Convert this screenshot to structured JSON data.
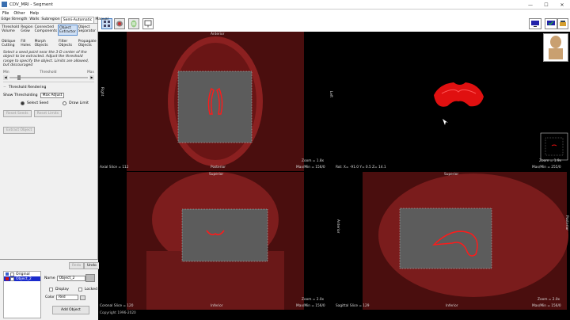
{
  "title_bar": {
    "title": "CDV_MRI - Segment",
    "minimize": "—",
    "maximize": "☐",
    "close": "✕"
  },
  "menu": [
    "File",
    "Other",
    "Help"
  ],
  "tabs": [
    "Edge Strength",
    "Walls",
    "Subregion",
    "Semi-Automatic",
    "Manual"
  ],
  "tools_row1": [
    "Threshold Volume",
    "Region Grow",
    "Connected Components",
    "Object Extractor",
    "Object Separator"
  ],
  "tools_row2": [
    "Oblique Cutting",
    "Fill Holes",
    "Morph Objects",
    "Filter Objects",
    "Propagate Objects"
  ],
  "description": "Select a seed point near the 3-D center of the object to be extracted. Adjust the threshold range to specify the object. Limits are allowed, but discouraged",
  "slider": {
    "min_label": "Min",
    "center_label": "Threshold",
    "max_label": "Max"
  },
  "threshold_rendering_label": "Threshold Rendering",
  "show_thresholding_label": "Show Thresholding",
  "show_thresholding_value": "Max Adjust",
  "radio_select_seed": "Select Seed",
  "radio_draw_limit": "Draw Limit",
  "reset_seeds": "Reset Seeds",
  "reset_limits": "Reset Limits",
  "extract_object": "Extract Object",
  "undo_panel": {
    "redo": "Redo",
    "undo": "Undo"
  },
  "objects": [
    {
      "name": "Original",
      "color": "#3a5fcd"
    },
    {
      "name": "Object_2",
      "color": "#d01010"
    }
  ],
  "object_props": {
    "name_label": "Name",
    "name_value": "Object_2",
    "display_label": "Display",
    "locked_label": "Locked",
    "color_label": "Color",
    "color_value": "Red",
    "add_object": "Add Object"
  },
  "views": {
    "axial": {
      "top": "Anterior",
      "bottom": "Posterior",
      "left": "Right",
      "right": "Left",
      "slice": "Axial Slice = 112",
      "zoom": "Zoom = 1.8x",
      "maxmin": "Max/Min = 156/0"
    },
    "render3d": {
      "coords": "Rot: X= -91.0 Y= 0.5 Z= 14.1",
      "zoom": "Zoom = 1.9x",
      "maxmin": "Max/Min = 255/0"
    },
    "coronal": {
      "top": "Superior",
      "bottom": "Inferior",
      "slice": "Coronal Slice = 120",
      "zoom": "Zoom = 2.0x",
      "maxmin": "Max/Min = 156/0"
    },
    "sagittal": {
      "top": "Superior",
      "bottom": "Inferior",
      "left": "Anterior",
      "right": "Posterior",
      "slice": "Sagittal Slice = 129",
      "zoom": "Zoom = 2.0x",
      "maxmin": "Max/Min = 156/0"
    }
  },
  "copyright": "Copyright 1996-2020",
  "colors": {
    "mask_red": "#8b1a1a",
    "seg_red": "#ff1a1a",
    "selected_blue": "#1a2bcc"
  }
}
